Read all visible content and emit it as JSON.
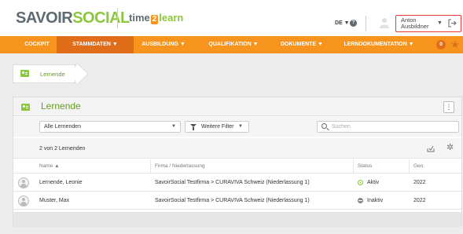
{
  "header": {
    "logo_part1": "SAVOIR",
    "logo_part2": "SOCIAL",
    "time2learn_part1": "time",
    "time2learn_two": "2",
    "time2learn_part2": "learn",
    "language": "DE ▼",
    "help": "?",
    "user_name_line1": "Anton",
    "user_name_line2": "Ausbildner",
    "user_dropdown": "▼"
  },
  "nav": {
    "items": [
      {
        "label": "COCKPIT"
      },
      {
        "label": "STAMMDATEN ▼"
      },
      {
        "label": "AUSBILDUNG ▼"
      },
      {
        "label": "QUALIFIKATION ▼"
      },
      {
        "label": "DOKUMENTE ▼"
      },
      {
        "label": "LERNDOKUMENTATION ▼"
      }
    ],
    "badge": "0",
    "star": "★"
  },
  "breadcrumb": {
    "label": "Lernende"
  },
  "panel": {
    "title": "Lernende",
    "menu": "⋮",
    "filter_select": "Alle Lernenden",
    "filter_caret": "▼",
    "more_filters": "Weitere Filter",
    "more_filters_caret": "▼",
    "search_placeholder": "Suchen",
    "count": "2 von 2 Lernenden",
    "columns": {
      "name": "Name ▲",
      "company": "Firma / Niederlassung",
      "status": "Status",
      "gen": "Gen."
    },
    "rows": [
      {
        "name": "Lernende, Leonie",
        "company": "SavoirSocial Testfirma > CURAVIVA Schweiz (Niederlassung 1)",
        "status": "Aktiv",
        "gen": "2022"
      },
      {
        "name": "Muster, Max",
        "company": "SavoirSocial Testfirma > CURAVIVA Schweiz (Niederlassung 1)",
        "status": "Inaktiv",
        "gen": "2022"
      }
    ]
  },
  "colors": {
    "brand_green": "#8cc63f",
    "brand_orange": "#f7941d",
    "nav_active": "#e06d1a",
    "highlight_red": "#e53935"
  }
}
